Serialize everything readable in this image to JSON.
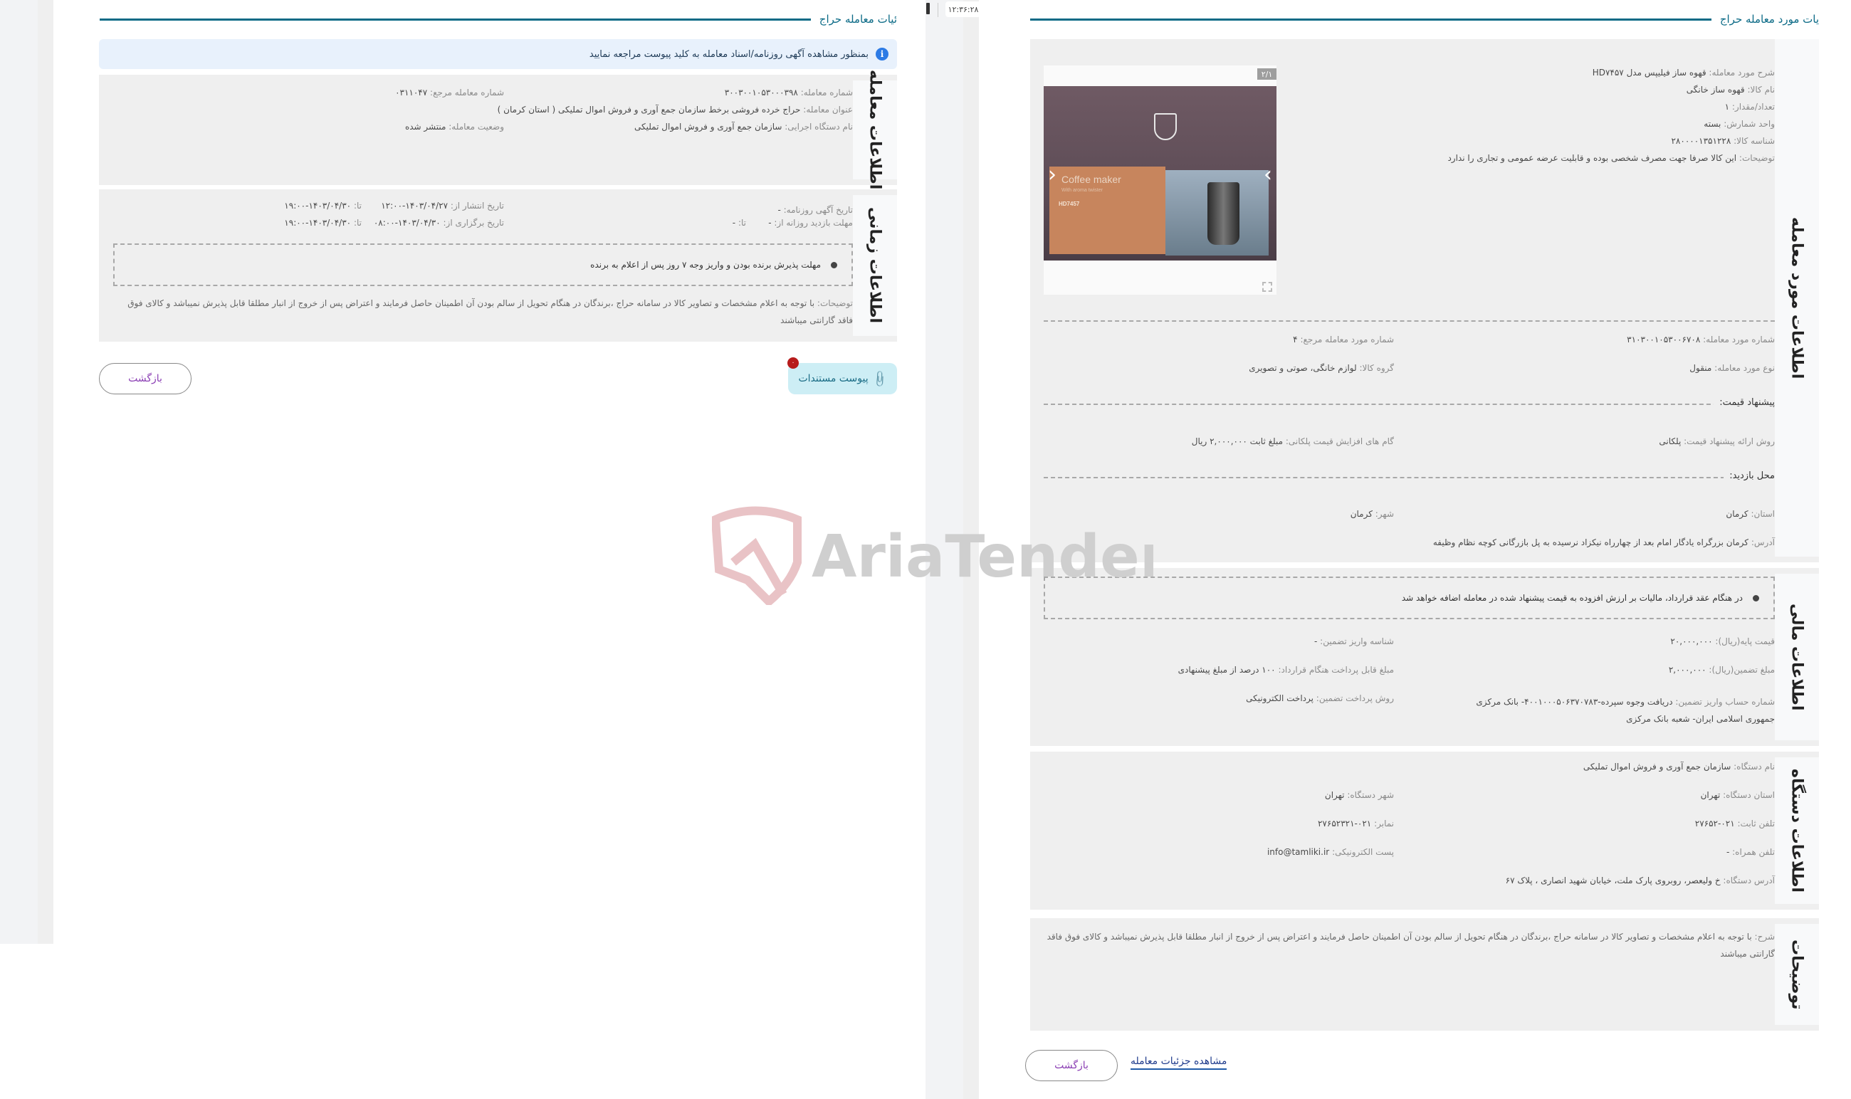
{
  "clock": {
    "time": "۱۲:۳۶:۲۸"
  },
  "left_panel": {
    "section_title": "ئیات معامله حراج",
    "info_banner": "بمنظور مشاهده آگهی روزنامه/اسناد معامله به کلید پیوست مراجعه نمایید",
    "deal_info": {
      "tab_label": "اطلاعات معامله",
      "fields": {
        "deal_number": {
          "label": "شماره معامله:",
          "value": "۳۰۰۳۰۰۱۰۵۳۰۰۰۳۹۸"
        },
        "ref_number": {
          "label": "شماره معامله مرجع:",
          "value": "۰۳۱۱۰۴۷"
        },
        "deal_title": {
          "label": "عنوان معامله:",
          "value": "حراج خرده فروشی برخط سازمان جمع آوری و فروش اموال تملیکی ( استان کرمان )"
        },
        "executor": {
          "label": "نام دستگاه اجرایی:",
          "value": "سازمان جمع آوری و فروش اموال تملیکی"
        },
        "status": {
          "label": "وضعیت معامله:",
          "value": "منتشر شده"
        }
      }
    },
    "time_info": {
      "tab_label": "اطلاعات زمانی",
      "fields": {
        "newspaper_date": {
          "label": "تاریخ آگهی روزنامه:",
          "value": "-"
        },
        "publish_from": {
          "label": "تاریخ انتشار از:",
          "value": "۱۴۰۳/۰۴/۲۷-۱۲:۰۰"
        },
        "publish_to": {
          "label": "تا:",
          "value": "۱۴۰۳/۰۴/۳۰-۱۹:۰۰"
        },
        "visit_from": {
          "label": "مهلت بازدید روزانه از:",
          "value": "-"
        },
        "visit_to": {
          "label": "تا:",
          "value": "-"
        },
        "hold_from": {
          "label": "تاریخ برگزاری از:",
          "value": "۱۴۰۳/۰۴/۳۰-۰۸:۰۰"
        },
        "hold_to": {
          "label": "تا:",
          "value": "۱۴۰۳/۰۴/۳۰-۱۹:۰۰"
        }
      },
      "notice": "مهلت پذیرش برنده بودن و واریز وجه ۷ روز پس از اعلام به برنده",
      "description_label": "توضیحات:",
      "description": "با توجه به اعلام مشخصات و تصاویر کالا در سامانه حراج ،برندگان در هنگام تحویل از سالم بودن آن اطمینان حاصل فرمایند و اعتراض پس از خروج از انبار مطلقا قابل پذیرش نمیباشد و کالای فوق فاقد گارانتی میباشند"
    },
    "attach_button": "پیوست مستندات",
    "attach_badge": "۰",
    "back_button": "بازگشت"
  },
  "right_panel": {
    "section_title": "یات مورد معامله حراج",
    "item_info": {
      "tab_label": "اطلاعات مورد معامله",
      "gallery": {
        "counter": "۲/۱",
        "photo_title": "Coffee maker",
        "photo_subtitle": "With aroma twister",
        "photo_model": "HD7457"
      },
      "fields": {
        "description": {
          "label": "شرح مورد معامله:",
          "value": "قهوه ساز فیلیپس مدل HD۷۴۵۷"
        },
        "goods_name": {
          "label": "نام کالا:",
          "value": "قهوه ساز خانگی"
        },
        "quantity": {
          "label": "تعداد/مقدار:",
          "value": "۱"
        },
        "unit": {
          "label": "واحد شمارش:",
          "value": "بسته"
        },
        "goods_id": {
          "label": "شناسه کالا:",
          "value": "۲۸۰۰۰۰۱۳۵۱۲۲۸"
        },
        "notes": {
          "label": "توضیحات:",
          "value": "این کالا صرفا جهت مصرف شخصی بوده و قابلیت عرضه عمومی و تجاری را ندارد"
        },
        "item_number": {
          "label": "شماره مورد معامله:",
          "value": "۳۱۰۳۰۰۱۰۵۳۰۰۶۷۰۸"
        },
        "item_ref": {
          "label": "شماره مورد معامله مرجع:",
          "value": "۴"
        },
        "item_type": {
          "label": "نوع مورد معامله:",
          "value": "منقول"
        },
        "goods_group": {
          "label": "گروه کالا:",
          "value": "لوازم خانگی، صوتی و تصویری"
        }
      },
      "price_offer": {
        "heading": "پیشنهاد قیمت:",
        "method": {
          "label": "روش ارائه پیشنهاد قیمت:",
          "value": "پلکانی"
        },
        "steps": {
          "label": "گام های افزایش قیمت پلکانی:",
          "value": "مبلغ ثابت ۲,۰۰۰,۰۰۰ ریال"
        }
      },
      "visit_place": {
        "heading": "محل بازدید:",
        "province": {
          "label": "استان:",
          "value": "کرمان"
        },
        "city": {
          "label": "شهر:",
          "value": "کرمان"
        },
        "address": {
          "label": "آدرس:",
          "value": "کرمان بزرگراه یادگار امام بعد از چهارراه نیکزاد نرسیده به پل بازرگانی کوچه نظام وظیفه"
        }
      }
    },
    "financial_info": {
      "tab_label": "اطلاعات مالی",
      "notice": "در هنگام عقد قرارداد، مالیات بر ارزش افزوده به قیمت پیشنهاد شده در معامله اضافه خواهد شد",
      "fields": {
        "base_price": {
          "label": "قیمت پایه(ریال):",
          "value": "۲۰,۰۰۰,۰۰۰"
        },
        "guarantee_id": {
          "label": "شناسه واریز تضمین:",
          "value": "-"
        },
        "guarantee_amount": {
          "label": "مبلغ تضمین(ریال):",
          "value": "۲,۰۰۰,۰۰۰"
        },
        "payable": {
          "label": "مبلغ قابل پرداخت هنگام قرارداد:",
          "value": "۱۰۰ درصد از مبلغ پیشنهادی"
        },
        "account": {
          "label": "شماره حساب واریز تضمین:",
          "value": "دریافت وجوه سپرده-۴۰۰۱۰۰۰۵۰۶۳۷۰۷۸۳- بانک مرکزی جمهوری اسلامی ایران- شعبه بانک مرکزی"
        },
        "payment_method": {
          "label": "روش پرداخت تضمین:",
          "value": "پرداخت الکترونیکی"
        }
      }
    },
    "org_info": {
      "tab_label": "اطلاعات دستگاه",
      "fields": {
        "org_name": {
          "label": "نام دستگاه:",
          "value": "سازمان جمع آوری و فروش اموال تملیکی"
        },
        "org_province": {
          "label": "استان دستگاه:",
          "value": "تهران"
        },
        "org_city": {
          "label": "شهر دستگاه:",
          "value": "تهران"
        },
        "phone": {
          "label": "تلفن ثابت:",
          "value": "۰۲۱-۲۷۶۵۲"
        },
        "fax": {
          "label": "نمابر:",
          "value": "۰۲۱-۲۷۶۵۲۳۲۱"
        },
        "mobile": {
          "label": "تلفن همراه:",
          "value": "-"
        },
        "email": {
          "label": "پست الکترونیکی:",
          "value": "info@tamliki.ir"
        },
        "address": {
          "label": "آدرس دستگاه:",
          "value": "خ ولیعصر، روبروی پارک ملت، خیابان شهید انصاری ، پلاک ۶۷"
        }
      }
    },
    "notes": {
      "tab_label": "توضیحات",
      "label": "شرح:",
      "text": "با توجه به اعلام مشخصات و تصاویر کالا در سامانه حراج ،برندگان در هنگام تحویل از سالم بودن آن اطمینان حاصل فرمایند و اعتراض پس از خروج از انبار مطلقا قابل پذیرش نمیباشد و کالای فوق فاقد گارانتی میباشند"
    },
    "view_details_link": "مشاهده جزئیات معامله",
    "back_button": "بازگشت"
  },
  "watermark": {
    "text": "AriaTender.neT"
  },
  "colors": {
    "accent": "#0b6a86",
    "info_bg": "#e8f1fc",
    "block_bg": "#efefef",
    "attach_bg": "#cdeef5",
    "badge": "#b71c1c",
    "back_text": "#8b3fb4"
  }
}
